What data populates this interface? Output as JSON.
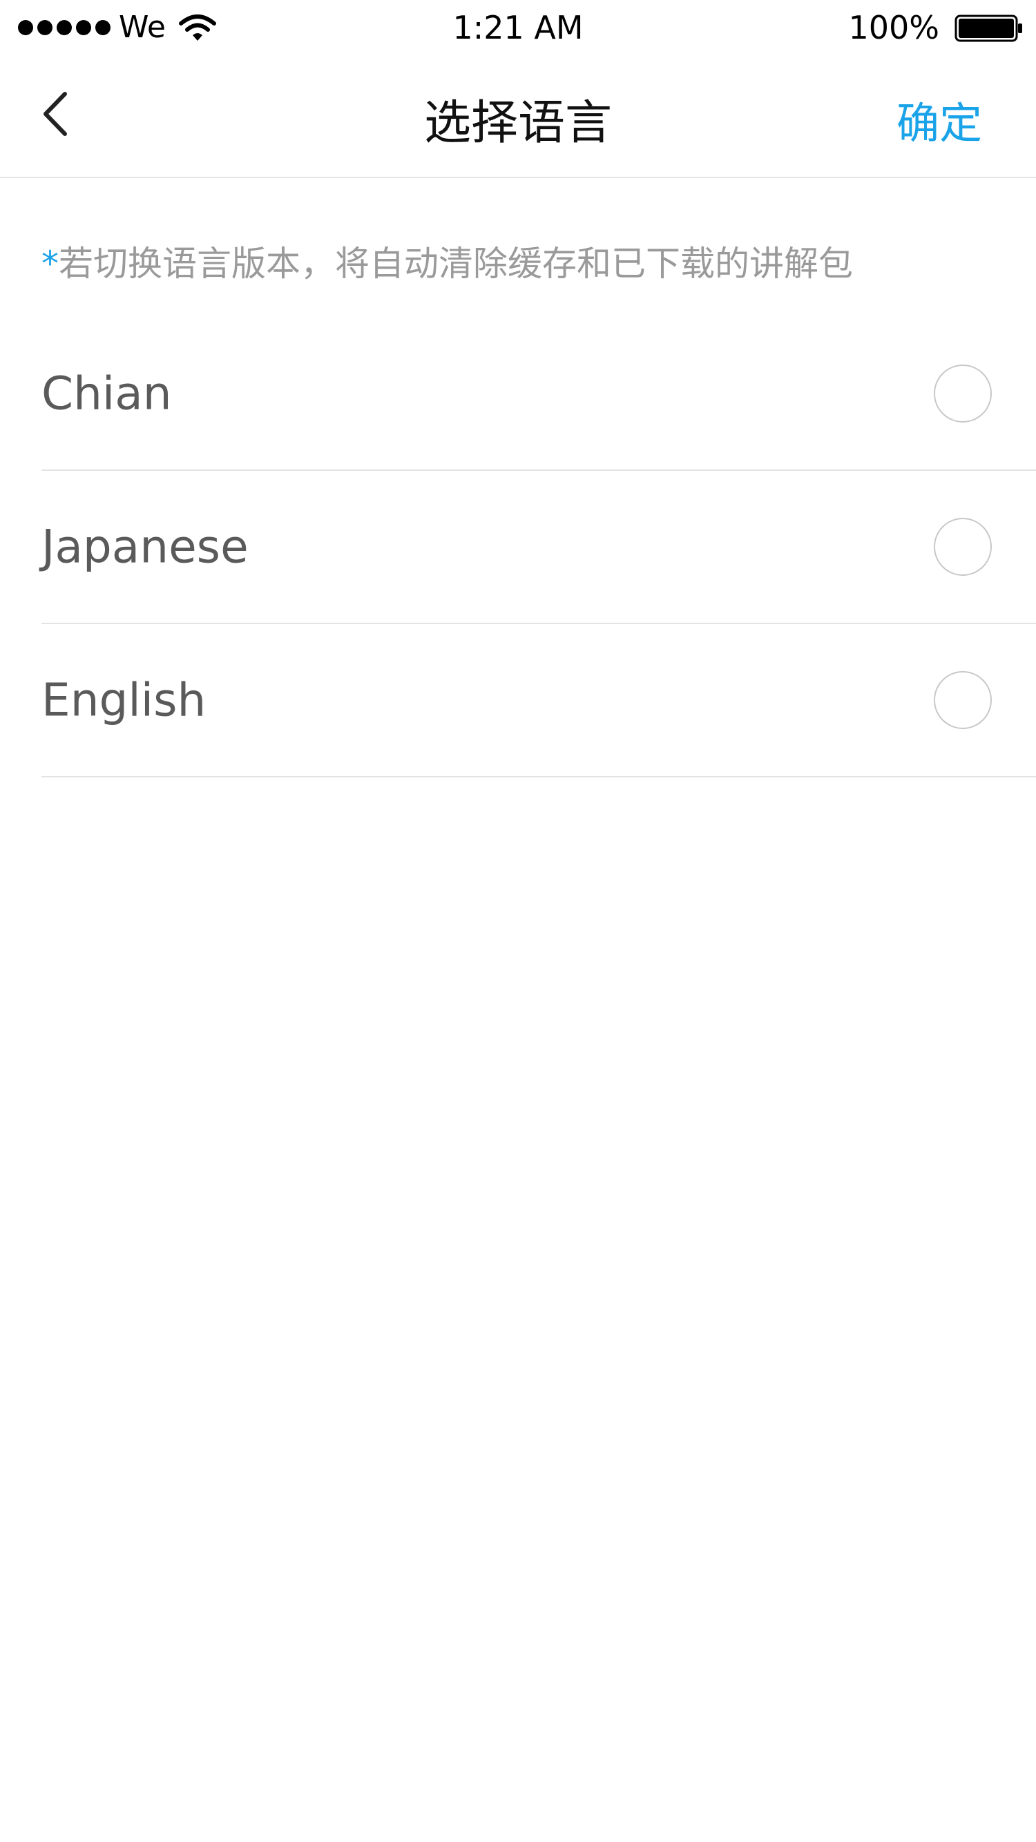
{
  "status_bar": {
    "carrier": "We",
    "time": "1:21 AM",
    "battery": "100%",
    "icons": [
      "signal-dots-icon",
      "wifi-icon",
      "battery-icon"
    ]
  },
  "nav": {
    "title": "选择语言",
    "confirm_label": "确定",
    "back_icon": "chevron-left-icon"
  },
  "notice": {
    "asterisk": "*",
    "text": "若切换语言版本，将自动清除缓存和已下载的讲解包"
  },
  "languages": [
    {
      "label": "Chian",
      "selected": false
    },
    {
      "label": "Japanese",
      "selected": false
    },
    {
      "label": "English",
      "selected": false
    }
  ],
  "colors": {
    "accent": "#1aa3e8",
    "label_text": "#5a5a5a",
    "notice_text": "#9a9a9a",
    "divider": "#e3e3e3"
  }
}
